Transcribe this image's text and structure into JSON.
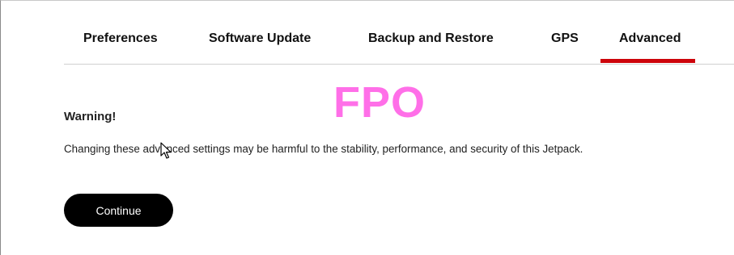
{
  "tabs": [
    {
      "label": "Preferences"
    },
    {
      "label": "Software Update"
    },
    {
      "label": "Backup and Restore"
    },
    {
      "label": "GPS"
    },
    {
      "label": "Advanced"
    }
  ],
  "active_tab": "Advanced",
  "accent_color": "#cd040b",
  "watermark": "FPO",
  "warning": {
    "title": "Warning!",
    "text": "Changing these advanced settings may be harmful to the stability, performance, and security of this Jetpack."
  },
  "continue_button": {
    "label": "Continue"
  },
  "icons": [
    "mouse-cursor-icon"
  ]
}
